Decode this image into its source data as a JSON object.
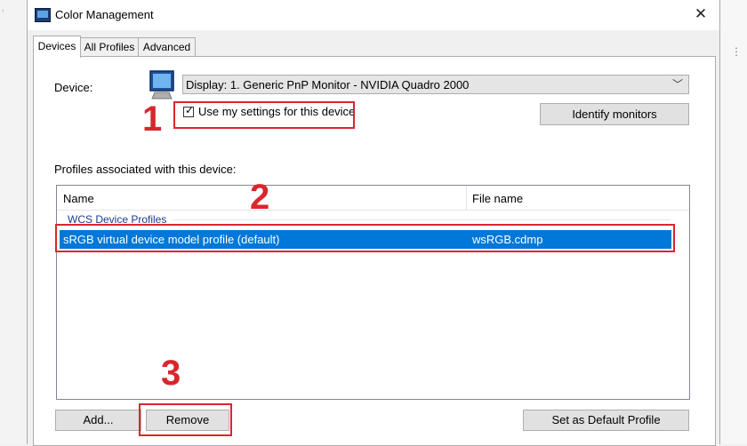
{
  "window": {
    "title": "Color Management",
    "close_glyph": "✕",
    "icon": "color-management-icon"
  },
  "tabs": [
    {
      "label": "Devices",
      "active": true
    },
    {
      "label": "All Profiles",
      "active": false
    },
    {
      "label": "Advanced",
      "active": false
    }
  ],
  "device": {
    "label": "Device:",
    "selected": "Display: 1. Generic PnP Monitor - NVIDIA Quadro 2000",
    "use_settings_label": "Use my settings for this device",
    "use_settings_checked": true,
    "identify_label": "Identify monitors"
  },
  "profiles": {
    "section_label": "Profiles associated with this device:",
    "columns": [
      "Name",
      "File name"
    ],
    "group_label": "WCS Device Profiles",
    "rows": [
      {
        "name": "sRGB virtual device model profile (default)",
        "file": "wsRGB.cdmp",
        "selected": true
      }
    ]
  },
  "buttons": {
    "add": "Add...",
    "remove": "Remove",
    "set_default": "Set as Default Profile"
  },
  "annotations": [
    "1",
    "2",
    "3"
  ],
  "colors": {
    "selection": "#0078d7",
    "annotation": "#d9262d",
    "group_text": "#1e3a8a"
  }
}
